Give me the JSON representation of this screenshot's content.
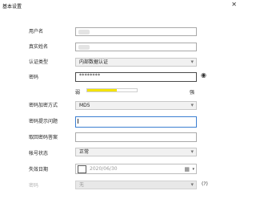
{
  "window": {
    "title": "基本设置",
    "close_glyph": "✕"
  },
  "form": {
    "username": {
      "label": "用户名"
    },
    "realname": {
      "label": "真实姓名"
    },
    "auth_type": {
      "label": "认证类型",
      "value": "内部数据认证"
    },
    "password": {
      "label": "密码",
      "value": "********"
    },
    "strength": {
      "weak": "弱",
      "strong": "强",
      "level": 0.6
    },
    "encryption": {
      "label": "密码加密方式",
      "value": "MD5"
    },
    "hint_question": {
      "label": "密码提示问题"
    },
    "hint_answer": {
      "label": "取回密码答案"
    },
    "account_status": {
      "label": "帐号状态",
      "value": "正常"
    },
    "expiry_date": {
      "label": "失效日期",
      "value": "2020/06/30"
    },
    "disabled_row": {
      "label": "密码",
      "value": "无",
      "help": "(?)"
    }
  },
  "icons": {
    "dropdown": "▾",
    "eye": "◉",
    "calendar": "▦"
  },
  "colors": {
    "strength_fill": "#f4e300",
    "focus_border": "#3c7fd1"
  }
}
